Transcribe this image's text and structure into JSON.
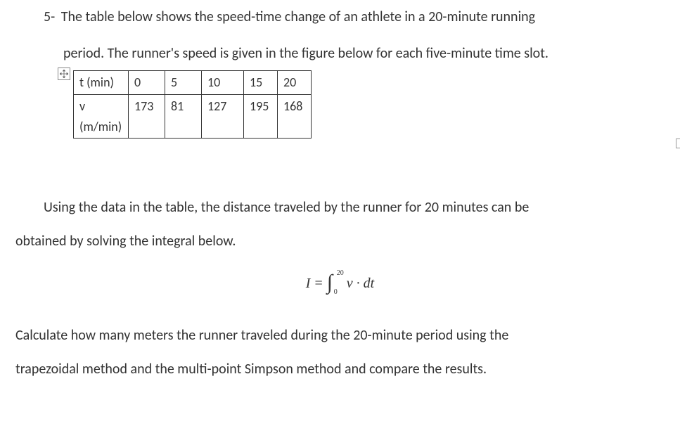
{
  "question": {
    "number": "5-",
    "line1": "The table below shows the speed-time change of an athlete in a 20-minute running",
    "line2": "period. The runner's speed is given in the figure below for each five-minute time slot."
  },
  "table": {
    "row1_header": "t (min)",
    "row2_header_line1": "v",
    "row2_header_line2": "(m/min)",
    "columns": [
      "0",
      "5",
      "10",
      "15",
      "20"
    ],
    "values": [
      "173",
      "81",
      "127",
      "195",
      "168"
    ]
  },
  "paragraph1_line1": "Using the data in the table, the distance traveled by the runner for 20 minutes can be",
  "paragraph1_line2": "obtained by solving the integral below.",
  "equation": {
    "lhs": "I",
    "eq": "=",
    "upper": "20",
    "lower": "0",
    "integrand": "v · dt"
  },
  "paragraph2_line1": "Calculate how many meters the runner traveled during the 20-minute period using the",
  "paragraph2_line2": "trapezoidal method and the multi-point Simpson method and compare the results.",
  "chart_data": {
    "type": "table",
    "title": "Speed-time data for 20-minute run",
    "columns": [
      "t (min)",
      "v (m/min)"
    ],
    "rows": [
      [
        0,
        173
      ],
      [
        5,
        81
      ],
      [
        10,
        127
      ],
      [
        15,
        195
      ],
      [
        20,
        168
      ]
    ]
  }
}
